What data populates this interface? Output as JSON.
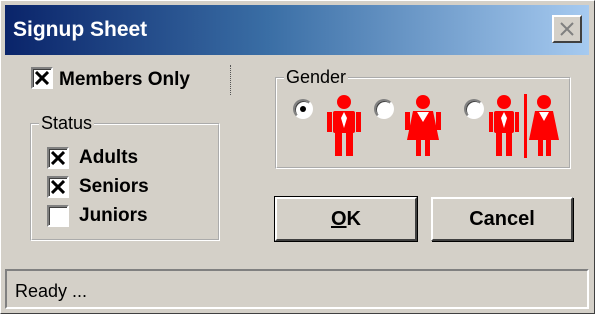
{
  "window": {
    "title": "Signup Sheet"
  },
  "members_only": {
    "label": "Members Only",
    "checked": true
  },
  "status_group": {
    "legend": "Status",
    "items": [
      {
        "label": "Adults",
        "checked": true
      },
      {
        "label": "Seniors",
        "checked": true
      },
      {
        "label": "Juniors",
        "checked": false
      }
    ]
  },
  "gender_group": {
    "legend": "Gender",
    "options": [
      {
        "icon": "male-figure-icon",
        "selected": true
      },
      {
        "icon": "female-figure-icon",
        "selected": false
      },
      {
        "icon": "male-female-figure-icon",
        "selected": false
      }
    ],
    "icon_color": "#ff0000"
  },
  "buttons": {
    "ok_label": "OK",
    "cancel_label": "Cancel"
  },
  "status_bar": {
    "text": "Ready ..."
  }
}
